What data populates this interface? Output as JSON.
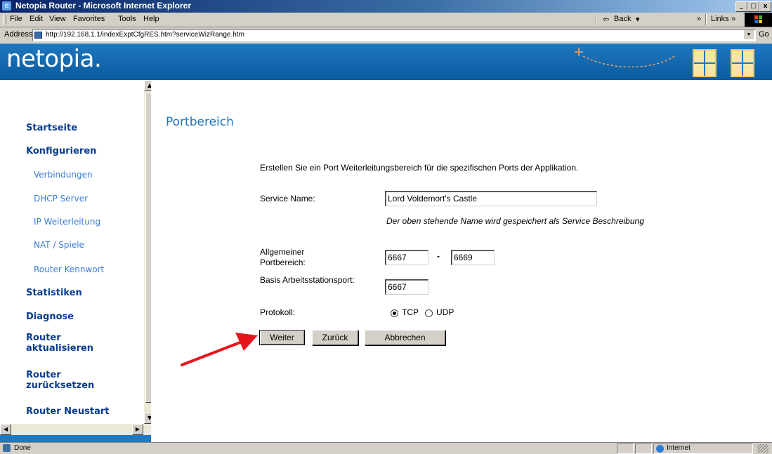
{
  "window": {
    "title": "Netopia Router - Microsoft Internet Explorer",
    "min_glyph": "_",
    "max_glyph": "□",
    "close_glyph": "x"
  },
  "menubar": {
    "items": [
      "File",
      "Edit",
      "View",
      "Favorites",
      "Tools",
      "Help"
    ],
    "back": "Back",
    "back_arrow": "⇦",
    "back_caret": "▾",
    "chevron": "»",
    "links": "Links"
  },
  "address": {
    "label": "Address",
    "url": "http://192.168.1.1/indexExptCfgRES.htm?serviceWizRange.htm",
    "go": "Go",
    "dropdown": "▼"
  },
  "brand": {
    "logo": "netopia."
  },
  "sidebar": {
    "items": [
      {
        "label": "Startseite",
        "type": "main"
      },
      {
        "label": "Konfigurieren",
        "type": "main"
      },
      {
        "label": "Verbindungen",
        "type": "sub"
      },
      {
        "label": "DHCP Server",
        "type": "sub"
      },
      {
        "label": "IP Weiterleitung",
        "type": "sub"
      },
      {
        "label": "NAT / Spiele",
        "type": "sub"
      },
      {
        "label": "Router Kennwort",
        "type": "sub"
      },
      {
        "label": "Statistiken",
        "type": "main"
      },
      {
        "label": "Diagnose",
        "type": "main"
      },
      {
        "label": "Router aktualisieren",
        "type": "main"
      },
      {
        "label": "Router zurücksetzen",
        "type": "main"
      },
      {
        "label": "Router Neustart",
        "type": "main"
      }
    ],
    "scroll_up": "▲",
    "scroll_down": "▼",
    "scroll_left": "◀",
    "scroll_right": "▶"
  },
  "main": {
    "heading": "Portbereich",
    "intro": "Erstellen Sie ein Port Weiterleitungsbereich für die spezifischen Ports der Applikation.",
    "service_name_label": "Service Name:",
    "service_name_value": "Lord Voldemort's Castle",
    "service_note": "Der oben stehende Name wird gespeichert als Service Beschreibung",
    "range_label": "Allgemeiner Portbereich:",
    "range_start": "6667",
    "range_sep": "-",
    "range_end": "6669",
    "base_port_label": "Basis Arbeitsstationsport:",
    "base_port_value": "6667",
    "protocol_label": "Protokoll:",
    "protocol_options": [
      "TCP",
      "UDP"
    ],
    "protocol_selected": "TCP",
    "buttons": {
      "next": "Weiter",
      "back": "Zurück",
      "cancel": "Abbrechen"
    },
    "arrow_color": "#e8141b"
  },
  "status": {
    "text": "Done",
    "zone": "Internet"
  },
  "colors": {
    "brand_blue": "#1f78c0",
    "nav_main": "#0a3d8f",
    "nav_sub": "#3a7bd5"
  }
}
